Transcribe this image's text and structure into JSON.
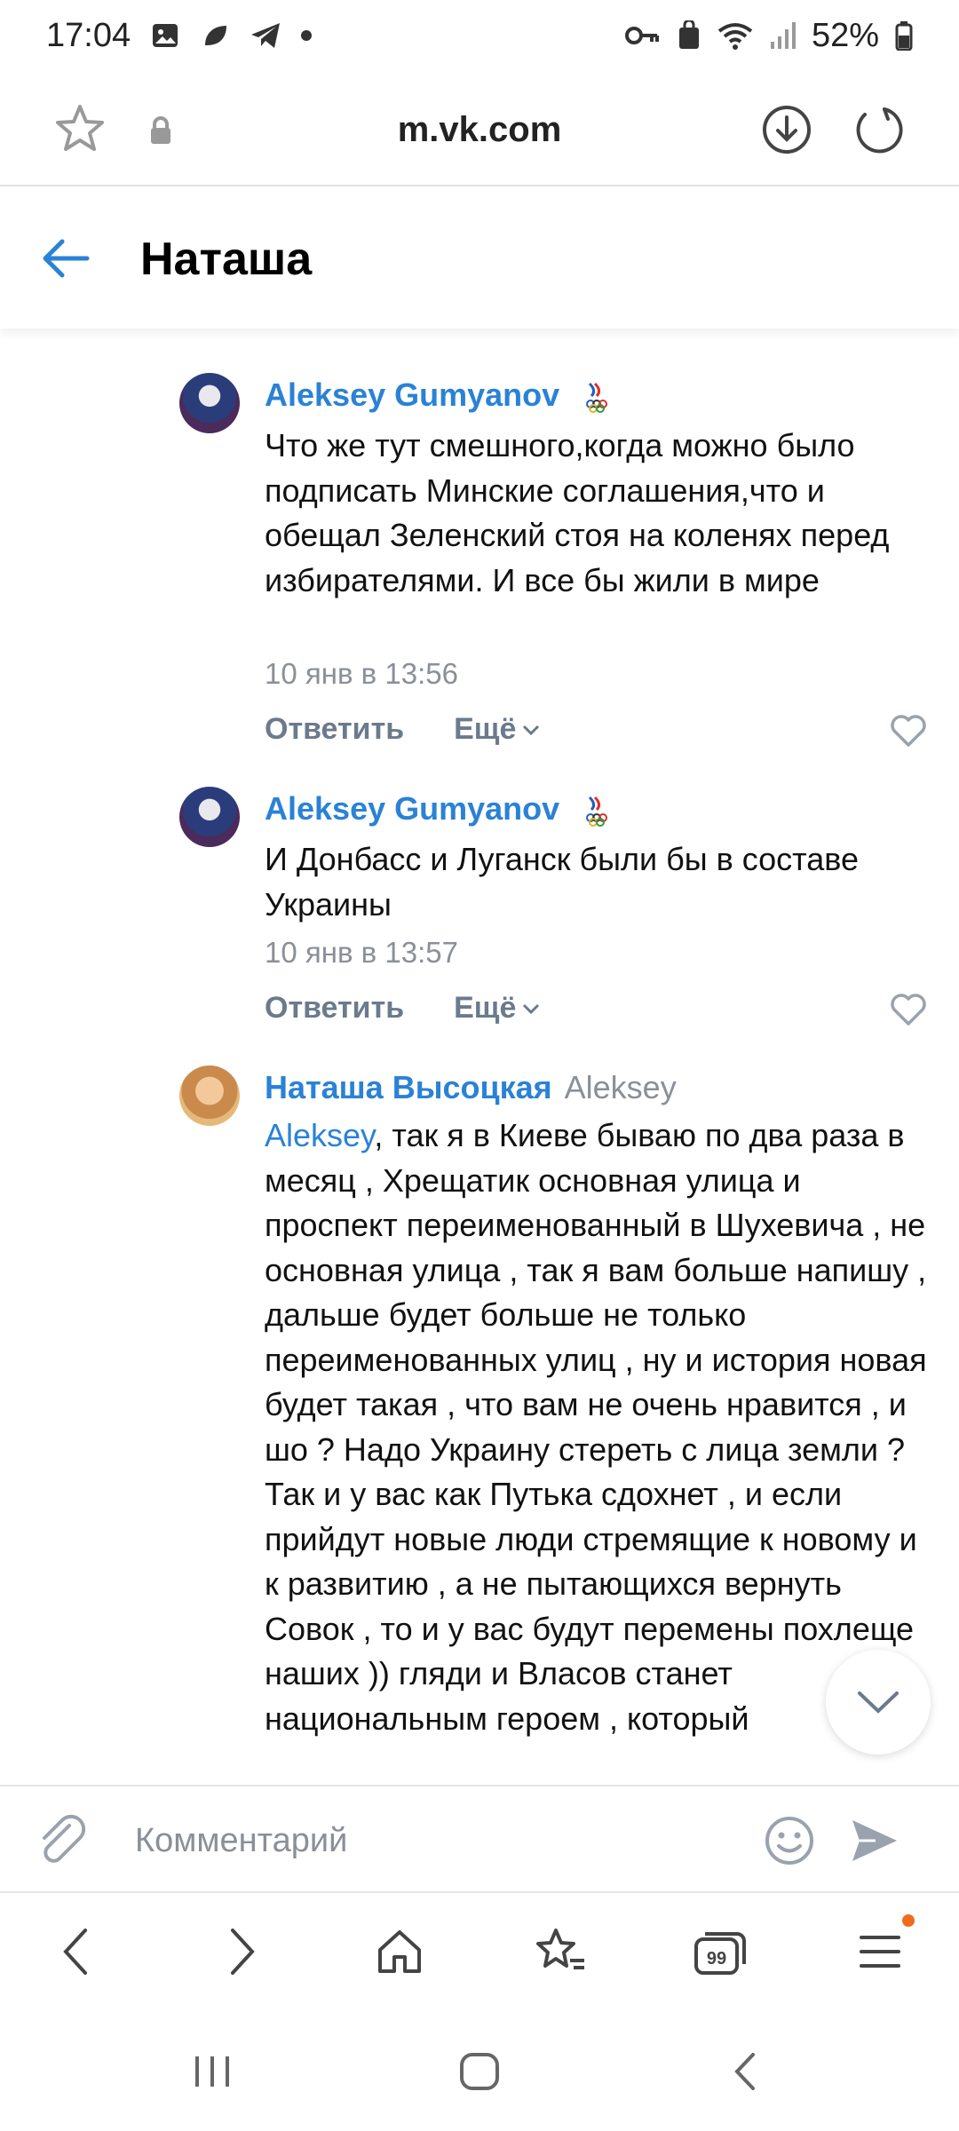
{
  "status_bar": {
    "time": "17:04",
    "battery": "52%"
  },
  "browser": {
    "url": "m.vk.com"
  },
  "page": {
    "title": "Наташа"
  },
  "comments": [
    {
      "author": "Aleksey Gumyanov",
      "text": "Что же тут смешного,когда можно было подписать Минские соглашения,что и обещал Зеленский стоя на коленях перед избирателями. И все бы жили в мире",
      "time": "10 янв в 13:56",
      "reply_label": "Ответить",
      "more_label": "Ещё"
    },
    {
      "author": "Aleksey Gumyanov",
      "text": "И Донбасс и Луганск были бы в составе Украины",
      "time": "10 янв в 13:57",
      "reply_label": "Ответить",
      "more_label": "Ещё"
    },
    {
      "author": "Наташа Высоцкая",
      "reply_to": "Aleksey",
      "mention": "Aleksey",
      "text": ", так я в Киеве бываю по два раза в месяц , Хрещатик основная улица и проспект переименованный в Шухевича , не основная улица , так я вам больше напишу , дальше будет больше не только переименованных улиц , ну и история новая будет такая , что вам не очень нравится , и шо ? Надо Украину стереть с лица земли ? Так и у вас как Путька сдохнет , и если прийдут новые люди стремящие к новому и к развитию , а не пытающихся вернуть Совок , то и у вас будут перемены похлеще наших )) гляди и Власов станет национальным героем , который"
    }
  ],
  "composer": {
    "placeholder": "Комментарий"
  },
  "colors": {
    "link": "#2a82d6",
    "muted": "#8a8f98",
    "action": "#6b7a8c",
    "notification_dot": "#f26b1d"
  }
}
